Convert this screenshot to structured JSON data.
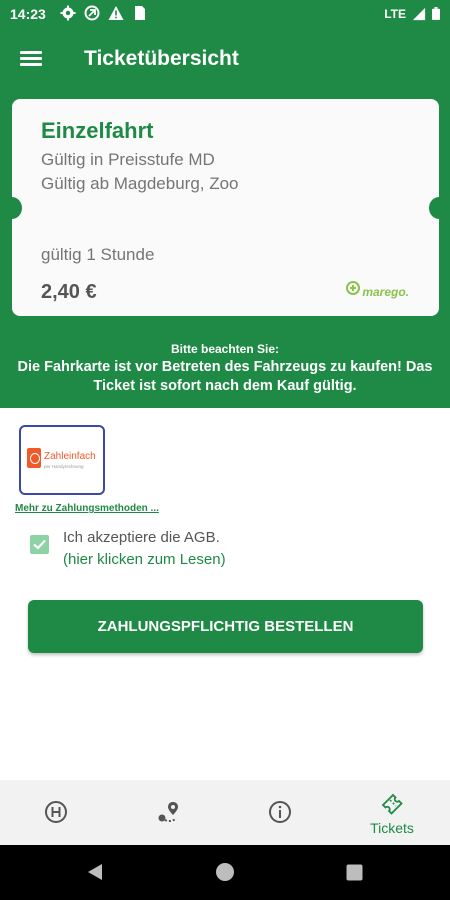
{
  "status_bar": {
    "time": "14:23",
    "network": "LTE",
    "icons_left": [
      "settings-icon",
      "vpn-icon",
      "warning-icon",
      "sim-icon"
    ],
    "icons_right": [
      "signal-icon",
      "battery-icon"
    ]
  },
  "app_bar": {
    "title": "Ticketübersicht",
    "menu_icon": "menu-icon"
  },
  "ticket": {
    "name": "Einzelfahrt",
    "line1": "Gültig in Preisstufe MD",
    "line2": "Gültig ab Magdeburg, Zoo",
    "validity": "gültig 1 Stunde",
    "price": "2,40 €",
    "brand": "marego."
  },
  "notice": {
    "heading": "Bitte beachten Sie:",
    "body": "Die Fahrkarte ist vor Betreten des Fahrzeugs zu kaufen! Das Ticket ist sofort nach dem Kauf gültig."
  },
  "payment": {
    "method_title": "Zahleinfach",
    "method_subtitle": "per Handyrechnung",
    "more_link": "Mehr zu Zahlungsmethoden ..."
  },
  "agb": {
    "checked": true,
    "text": "Ich akzeptiere die AGB.",
    "link": "(hier klicken zum Lesen)"
  },
  "order_button": {
    "label": "ZAHLUNGSPFLICHTIG BESTELLEN"
  },
  "bottom_nav": {
    "items": [
      {
        "icon": "stop-icon",
        "label": ""
      },
      {
        "icon": "route-icon",
        "label": ""
      },
      {
        "icon": "info-icon",
        "label": ""
      },
      {
        "icon": "ticket-icon",
        "label": "Tickets",
        "active": true
      }
    ]
  },
  "colors": {
    "brand_green": "#1f8a45",
    "checkbox_green": "#8ed3a5",
    "payment_orange": "#f05a28",
    "payment_border": "#3b4aa8"
  },
  "system_nav": {
    "buttons": [
      "back-icon",
      "home-icon",
      "recents-icon"
    ]
  }
}
